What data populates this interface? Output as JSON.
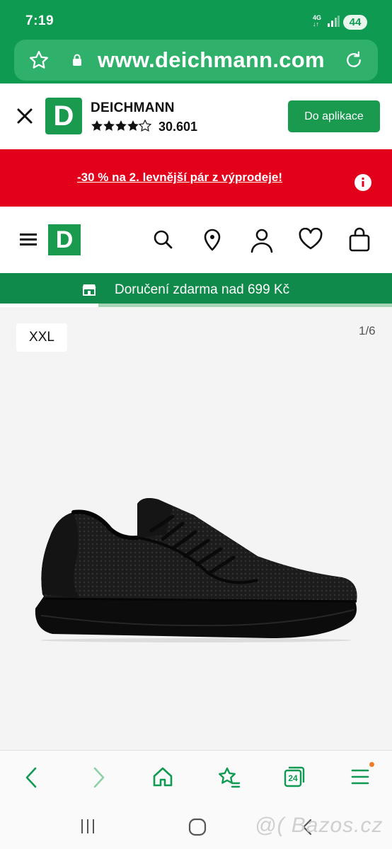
{
  "status_bar": {
    "time": "7:19",
    "network": "4G",
    "battery": "44"
  },
  "url_bar": {
    "url": "www.deichmann.com",
    "icons": [
      "star-icon",
      "lock-icon",
      "reload-icon"
    ]
  },
  "app_banner": {
    "logo_letter": "D",
    "name": "DEICHMANN",
    "rating": "30.601",
    "stars_count": 4.5,
    "button_label": "Do aplikace"
  },
  "promo": {
    "text": "-30 % na 2. levnější pár z výprodeje!"
  },
  "nav": {
    "logo_letter": "D",
    "icons": [
      "menu-icon",
      "search-icon",
      "location-icon",
      "account-icon",
      "heart-icon",
      "bag-icon"
    ]
  },
  "delivery": {
    "text": "Doručení zdarma nad 699 Kč",
    "progress": 0.25
  },
  "product": {
    "tag": "XXL",
    "counter": "1/6"
  },
  "browser_toolbar": {
    "icons": [
      "back-icon",
      "forward-icon",
      "home-icon",
      "bookmarks-icon",
      "tabs-icon",
      "menu-icon"
    ],
    "tabs_count": "24"
  },
  "system_nav": {
    "icons": [
      "recents-icon",
      "home-icon",
      "back-icon"
    ]
  },
  "watermark": "@( Bazos.cz",
  "colors": {
    "brand_green": "#1a9a4f",
    "status_green": "#0f9a52",
    "promo_red": "#e2001a",
    "notification_dot": "#f07c2a"
  }
}
